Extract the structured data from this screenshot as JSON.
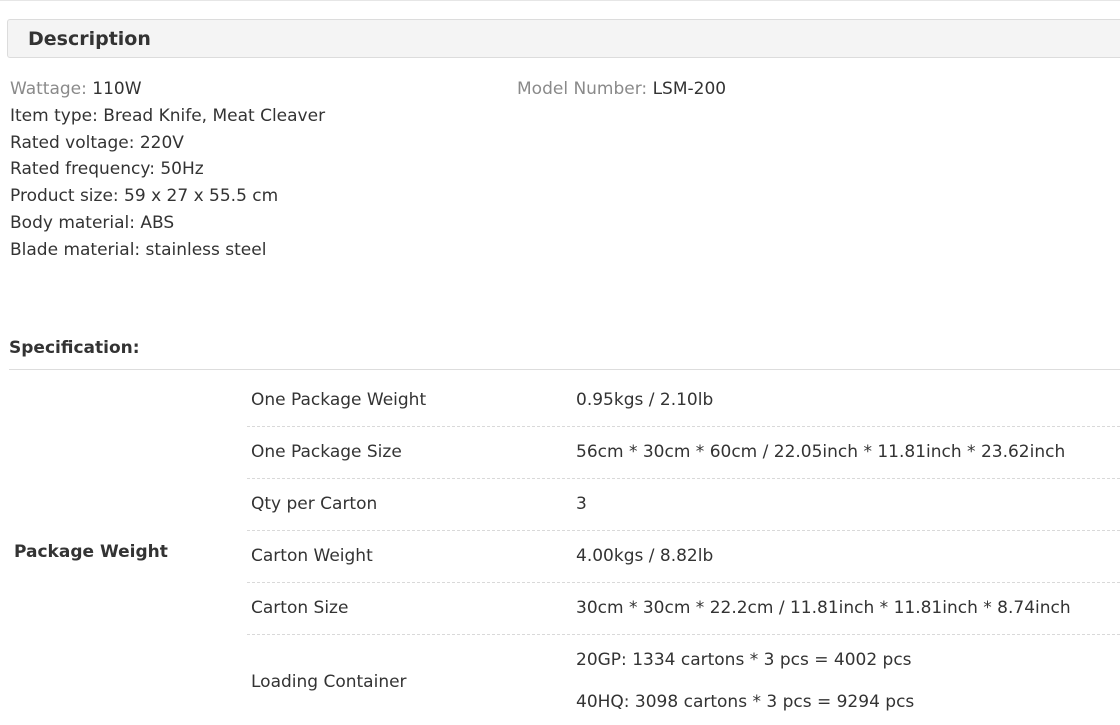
{
  "description": {
    "title": "Description"
  },
  "attributes": [
    {
      "label": "Wattage:",
      "value": "110W",
      "muted": true
    },
    {
      "label": "Item type:",
      "value": "Bread Knife, Meat Cleaver",
      "muted": false
    },
    {
      "label": "Rated voltage:",
      "value": "220V",
      "muted": false
    },
    {
      "label": "Rated frequency:",
      "value": "50Hz",
      "muted": false
    },
    {
      "label": "Product size:",
      "value": "59 x 27 x 55.5 cm",
      "muted": false
    },
    {
      "label": "Body material:",
      "value": "ABS",
      "muted": false
    },
    {
      "label": "Blade material:",
      "value": "stainless steel",
      "muted": false
    }
  ],
  "model": {
    "label": "Model Number:",
    "value": "LSM-200"
  },
  "specification": {
    "title": "Specification:",
    "group_label": "Package Weight",
    "rows": [
      {
        "key": "One Package Weight",
        "value": "0.95kgs / 2.10lb"
      },
      {
        "key": "One Package Size",
        "value": "56cm * 30cm * 60cm / 22.05inch * 11.81inch * 23.62inch"
      },
      {
        "key": "Qty per Carton",
        "value": "3"
      },
      {
        "key": "Carton Weight",
        "value": "4.00kgs / 8.82lb"
      },
      {
        "key": "Carton Size",
        "value": "30cm * 30cm * 22.2cm / 11.81inch * 11.81inch * 8.74inch"
      }
    ],
    "loading": {
      "key": "Loading Container",
      "values": [
        "20GP: 1334 cartons * 3 pcs = 4002 pcs",
        "40HQ: 3098 cartons * 3 pcs = 9294 pcs"
      ]
    }
  }
}
